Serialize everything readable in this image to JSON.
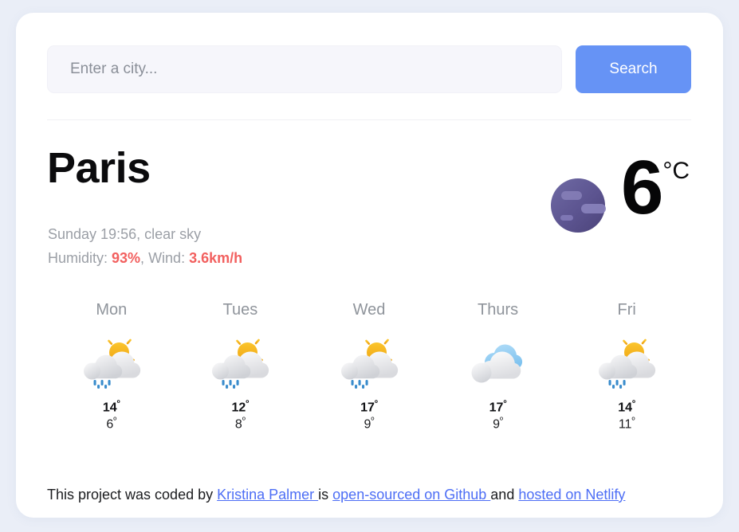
{
  "search": {
    "placeholder": "Enter a city...",
    "value": "",
    "button_label": "Search"
  },
  "current": {
    "city": "Paris",
    "datetime_condition": "Sunday 19:56, clear sky",
    "humidity_label": "Humidity: ",
    "humidity_value": "93%",
    "separator": ", ",
    "wind_label": "Wind: ",
    "wind_value": "3.6km/h",
    "temperature": "6",
    "unit": "°C",
    "icon": "moon-clear-sky-icon"
  },
  "forecast": [
    {
      "day": "Mon",
      "icon": "sun-behind-rain-cloud-icon",
      "max": "14",
      "min": "6",
      "deg": "º"
    },
    {
      "day": "Tues",
      "icon": "sun-behind-rain-cloud-icon",
      "max": "12",
      "min": "8",
      "deg": "º"
    },
    {
      "day": "Wed",
      "icon": "sun-behind-rain-cloud-icon",
      "max": "17",
      "min": "9",
      "deg": "º"
    },
    {
      "day": "Thurs",
      "icon": "broken-clouds-icon",
      "max": "17",
      "min": "9",
      "deg": "º"
    },
    {
      "day": "Fri",
      "icon": "sun-behind-rain-cloud-icon",
      "max": "14",
      "min": "11",
      "deg": "º"
    }
  ],
  "footer": {
    "text_1": "This project was coded by ",
    "link_author": "Kristina Palmer ",
    "text_2": "is ",
    "link_github": "open-sourced on Github ",
    "text_3": "and ",
    "link_netlify": "hosted on Netlify"
  },
  "colors": {
    "page_background": "#eaeef7",
    "card_background": "#ffffff",
    "accent_blue": "#6693f5",
    "link_blue": "#4d6ef5",
    "hot_red": "#f2605f",
    "muted_gray": "#9b9fa6",
    "sun_amber": "#f0a91e",
    "rain_blue": "#3a8ccc",
    "moon_purple": "#5c5490"
  }
}
